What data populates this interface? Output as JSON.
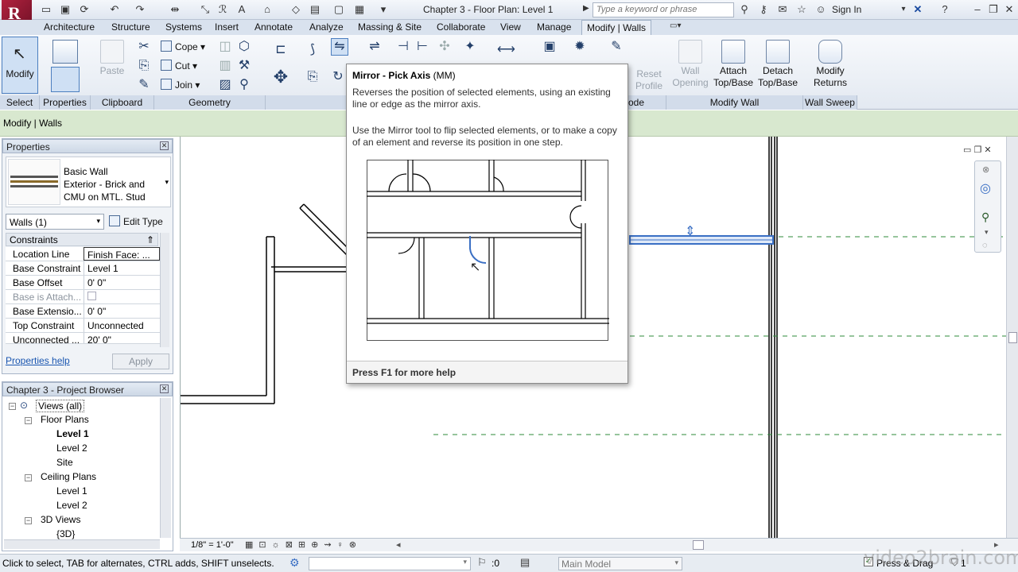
{
  "app": {
    "logo_letter": "R",
    "document_title": "Chapter 3 - Floor Plan: Level 1",
    "search_placeholder": "Type a keyword or phrase",
    "sign_in_label": "Sign In"
  },
  "ribbon_tabs": [
    "Architecture",
    "Structure",
    "Systems",
    "Insert",
    "Annotate",
    "Analyze",
    "Massing & Site",
    "Collaborate",
    "View",
    "Manage",
    "Modify | Walls"
  ],
  "active_tab": "Modify | Walls",
  "ribbon": {
    "select": {
      "modify_label": "Modify",
      "panel_label": "Select"
    },
    "properties": {
      "panel_label": "Properties"
    },
    "clipboard": {
      "paste_label": "Paste",
      "panel_label": "Clipboard"
    },
    "geometry": {
      "cope_label": "Cope",
      "cut_label": "Cut",
      "join_label": "Join",
      "panel_label": "Geometry"
    },
    "mode": {
      "reset_profile_label": "Reset Profile",
      "panel_label_fragment": "ode"
    },
    "modify_wall": {
      "wall_opening_label": "Wall Opening",
      "attach_label": "Attach Top/Base",
      "detach_label": "Detach Top/Base",
      "panel_label": "Modify Wall"
    },
    "wall_sweep": {
      "modify_returns_label": "Modify Returns",
      "panel_label": "Wall Sweep"
    }
  },
  "options_bar": {
    "context_label": "Modify | Walls"
  },
  "tooltip": {
    "title": "Mirror - Pick Axis",
    "shortcut": "(MM)",
    "description": "Reverses the position of selected elements, using an existing line or edge as the mirror axis.",
    "detail": "Use the Mirror tool to flip selected elements, or to make a copy of an element and reverse its position in one step.",
    "footer": "Press F1 for more help"
  },
  "properties_panel": {
    "title": "Properties",
    "type_name": "Basic Wall",
    "type_detail": "Exterior - Brick and CMU on MTL. Stud",
    "selector": "Walls (1)",
    "edit_type_label": "Edit Type",
    "section": "Constraints",
    "rows": [
      {
        "key": "Location Line",
        "value": "Finish Face: ..."
      },
      {
        "key": "Base Constraint",
        "value": "Level 1"
      },
      {
        "key": "Base Offset",
        "value": "0'  0\""
      },
      {
        "key": "Base is Attach...",
        "value": ""
      },
      {
        "key": "Base Extensio...",
        "value": "0'  0\""
      },
      {
        "key": "Top Constraint",
        "value": "Unconnected"
      },
      {
        "key": "Unconnected ...",
        "value": "20'  0\""
      }
    ],
    "help_link": "Properties help",
    "apply_label": "Apply"
  },
  "project_browser": {
    "title": "Chapter 3 - Project Browser",
    "root": "Views (all)",
    "floor_plans_label": "Floor Plans",
    "floor_plans": [
      "Level 1",
      "Level 2",
      "Site"
    ],
    "ceiling_plans_label": "Ceiling Plans",
    "ceiling_plans": [
      "Level 1",
      "Level 2"
    ],
    "views_3d_label": "3D Views",
    "views_3d": [
      "{3D}"
    ]
  },
  "view_bar": {
    "scale": "1/8\" = 1'-0\""
  },
  "status_bar": {
    "hint": "Click to select, TAB for alternates, CTRL adds, SHIFT unselects.",
    "filter_count": ":0",
    "model": "Main Model",
    "press_drag": "Press & Drag",
    "selection_count": "1"
  },
  "watermark": "video2brain.com",
  "colors": {
    "accent": "#3a6fc4",
    "options_bar": "#d8e8cf",
    "level_line": "#2e8b3a",
    "logo": "#a01e3a"
  }
}
